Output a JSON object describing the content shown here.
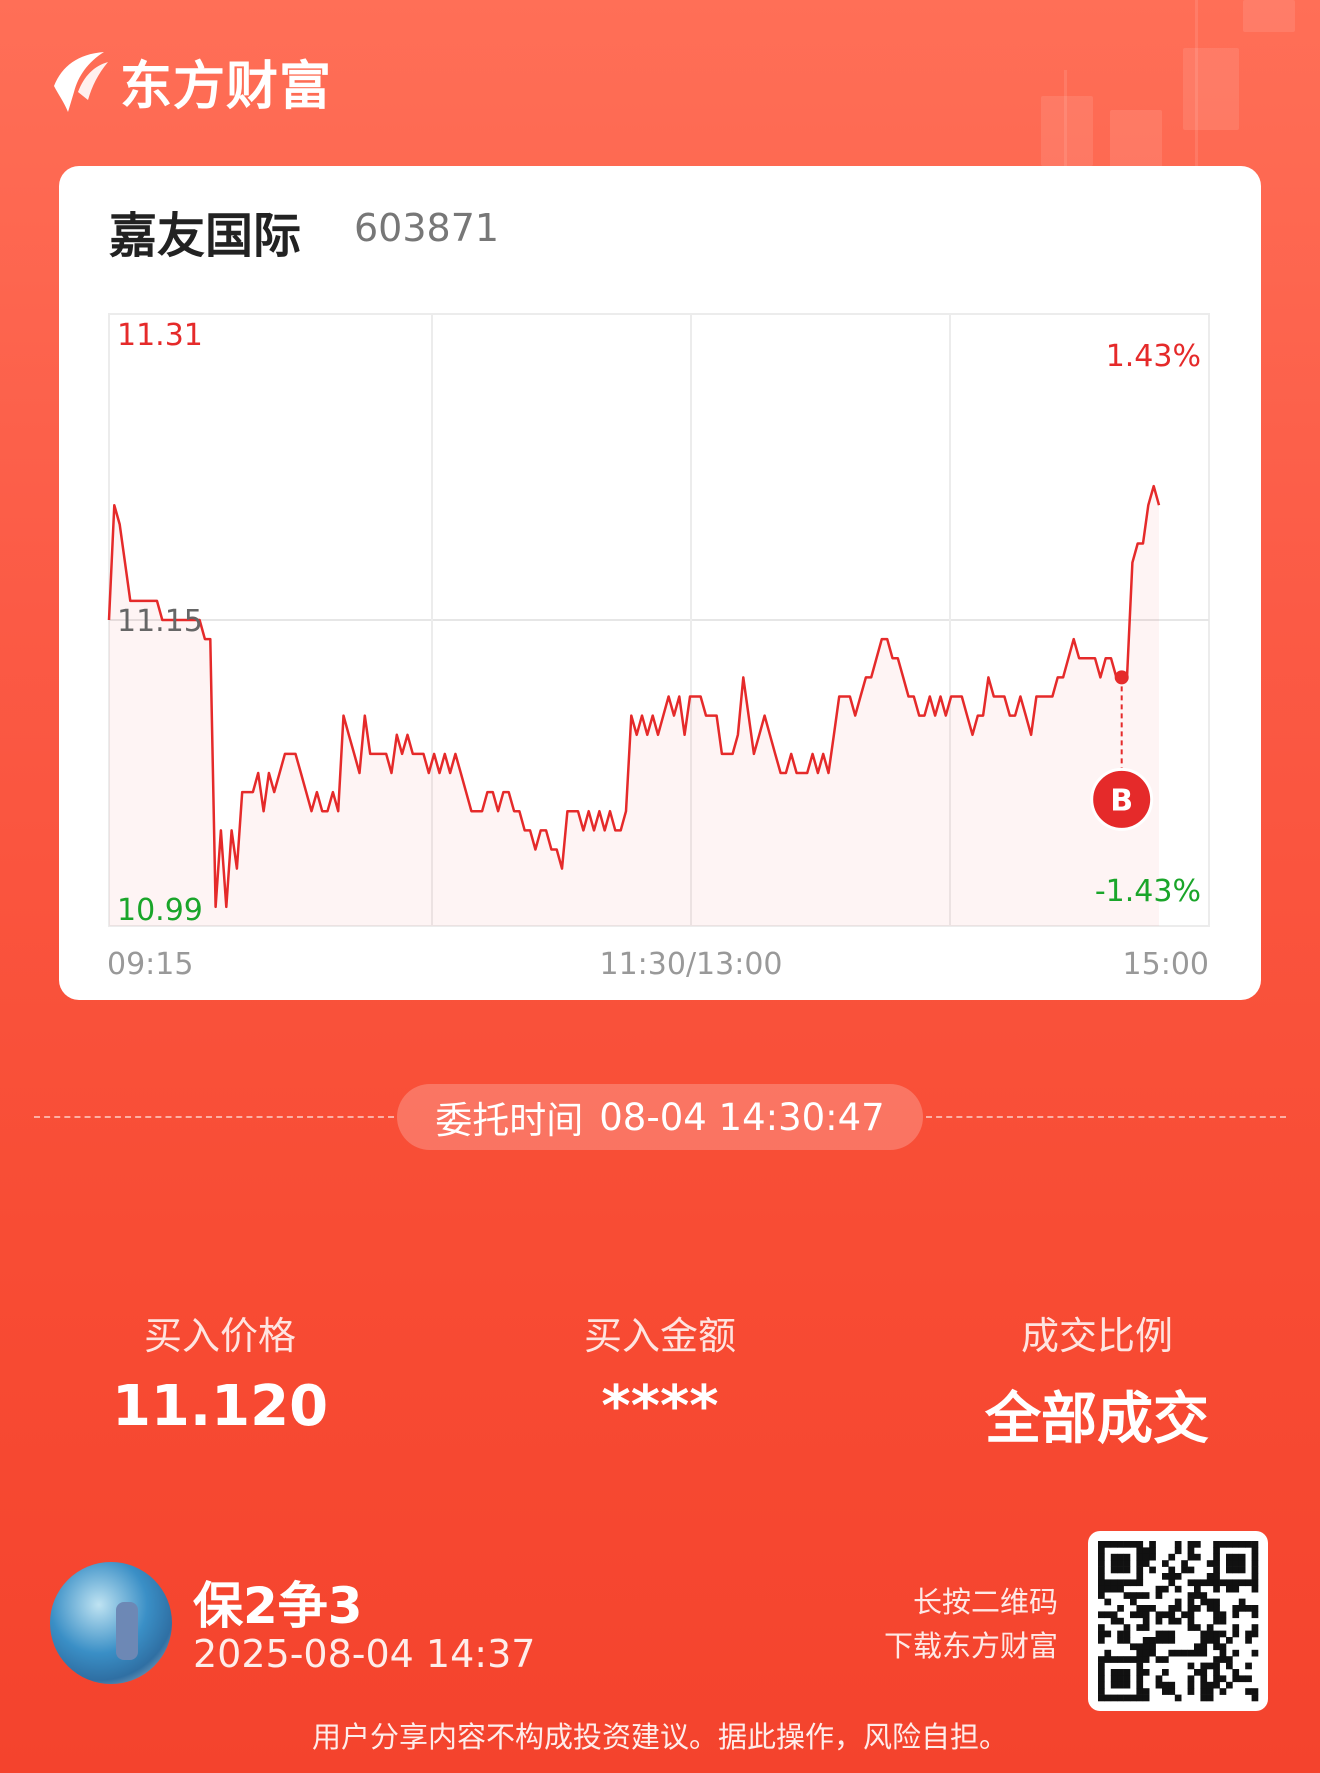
{
  "brand": {
    "name": "东方财富",
    "icon": "eastmoney-logo-icon"
  },
  "stock": {
    "name": "嘉友国际",
    "code": "603871"
  },
  "chart_data": {
    "type": "line",
    "y_left_max_label": "11.31",
    "y_left_mid_label": "11.15",
    "y_left_min_label": "10.99",
    "y_right_max_label": "1.43%",
    "y_right_min_label": "-1.43%",
    "x_tick_labels": [
      "09:15",
      "11:30/13:00",
      "15:00"
    ],
    "ylim": [
      10.99,
      11.31
    ],
    "prev_close": 11.15,
    "series": [
      {
        "values": [
          11.15,
          11.21,
          11.2,
          11.18,
          11.16,
          11.16,
          11.16,
          11.16,
          11.16,
          11.16,
          11.15,
          11.15,
          11.15,
          11.15,
          11.15,
          11.15,
          11.15,
          11.15,
          11.14,
          11.14,
          11.0,
          11.04,
          11.0,
          11.04,
          11.02,
          11.06,
          11.06,
          11.06,
          11.07,
          11.05,
          11.07,
          11.06,
          11.07,
          11.08,
          11.08,
          11.08,
          11.07,
          11.06,
          11.05,
          11.06,
          11.05,
          11.05,
          11.06,
          11.05,
          11.1,
          11.09,
          11.08,
          11.07,
          11.1,
          11.08,
          11.08,
          11.08,
          11.08,
          11.07,
          11.09,
          11.08,
          11.09,
          11.08,
          11.08,
          11.08,
          11.07,
          11.08,
          11.07,
          11.08,
          11.07,
          11.08,
          11.07,
          11.06,
          11.05,
          11.05,
          11.05,
          11.06,
          11.06,
          11.05,
          11.06,
          11.06,
          11.05,
          11.05,
          11.04,
          11.04,
          11.03,
          11.04,
          11.04,
          11.03,
          11.03,
          11.02,
          11.05,
          11.05,
          11.05,
          11.04,
          11.05,
          11.04,
          11.05,
          11.04,
          11.05,
          11.04,
          11.04,
          11.05,
          11.1,
          11.09,
          11.1,
          11.09,
          11.1,
          11.09,
          11.1,
          11.11,
          11.1,
          11.11,
          11.09,
          11.11,
          11.11,
          11.11,
          11.1,
          11.1,
          11.1,
          11.08,
          11.08,
          11.08,
          11.09,
          11.12,
          11.1,
          11.08,
          11.09,
          11.1,
          11.09,
          11.08,
          11.07,
          11.07,
          11.08,
          11.07,
          11.07,
          11.07,
          11.08,
          11.07,
          11.08,
          11.07,
          11.09,
          11.11,
          11.11,
          11.11,
          11.1,
          11.11,
          11.12,
          11.12,
          11.13,
          11.14,
          11.14,
          11.13,
          11.13,
          11.12,
          11.11,
          11.11,
          11.1,
          11.1,
          11.11,
          11.1,
          11.11,
          11.1,
          11.11,
          11.11,
          11.11,
          11.1,
          11.09,
          11.1,
          11.1,
          11.12,
          11.11,
          11.11,
          11.11,
          11.1,
          11.1,
          11.11,
          11.1,
          11.09,
          11.11,
          11.11,
          11.11,
          11.11,
          11.12,
          11.12,
          11.13,
          11.14,
          11.13,
          11.13,
          11.13,
          11.13,
          11.12,
          11.13,
          11.13,
          11.12,
          11.12,
          11.12,
          11.18,
          11.19,
          11.19,
          11.21,
          11.22,
          11.21
        ]
      }
    ],
    "buy_marker": {
      "label": "B",
      "time_index": 190,
      "price": 11.12
    }
  },
  "order": {
    "label": "委托时间",
    "time": "08-04 14:30:47"
  },
  "stats": [
    {
      "label": "买入价格",
      "value": "11.120"
    },
    {
      "label": "买入金额",
      "value": "****"
    },
    {
      "label": "成交比例",
      "value": "全部成交"
    }
  ],
  "user": {
    "name": "保2争3",
    "date": "2025-08-04 14:37"
  },
  "qr": {
    "hint_line1": "长按二维码",
    "hint_line2": "下载东方财富"
  },
  "disclaimer": "用户分享内容不构成投资建议。据此操作，风险自担。",
  "colors": {
    "up": "#e52a2a",
    "down": "#1aa52a",
    "card_bg": "#ffffff",
    "pill": "#ff8a73"
  }
}
